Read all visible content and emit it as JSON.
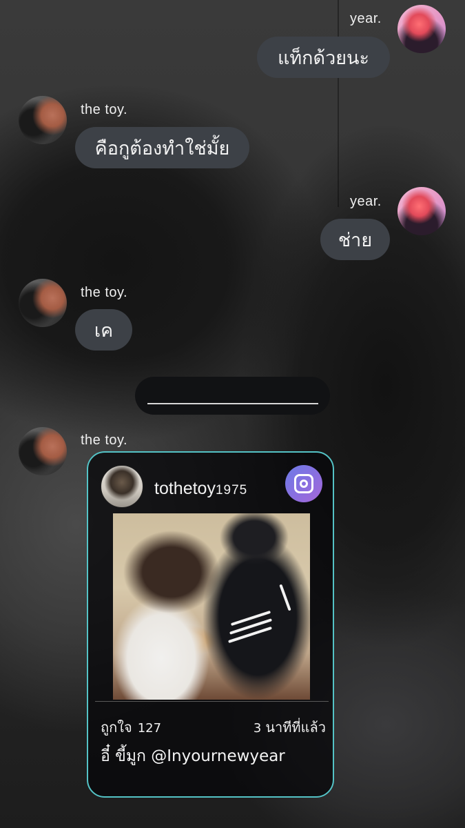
{
  "chat": {
    "messages": [
      {
        "sender": "year.",
        "text": "แท็กด้วยนะ",
        "side": "right"
      },
      {
        "sender": "the toy.",
        "text": "คือกูต้องทำใช่มั้ย",
        "side": "left"
      },
      {
        "sender": "year.",
        "text": "ช่าย",
        "side": "right"
      },
      {
        "sender": "the toy.",
        "text": "เค",
        "side": "left"
      }
    ],
    "post_sender": "the toy."
  },
  "shared_post": {
    "username": "tothetoy",
    "username_suffix": "1975",
    "likes_label": "ถูกใจ",
    "likes_count": "127",
    "time_number": "3",
    "time_label": "นาทีที่แล้ว",
    "caption": "อี๋ ขี้มูก @Inyournewyear",
    "accent_color": "#54c3c6",
    "platform_icon": "instagram-icon"
  }
}
